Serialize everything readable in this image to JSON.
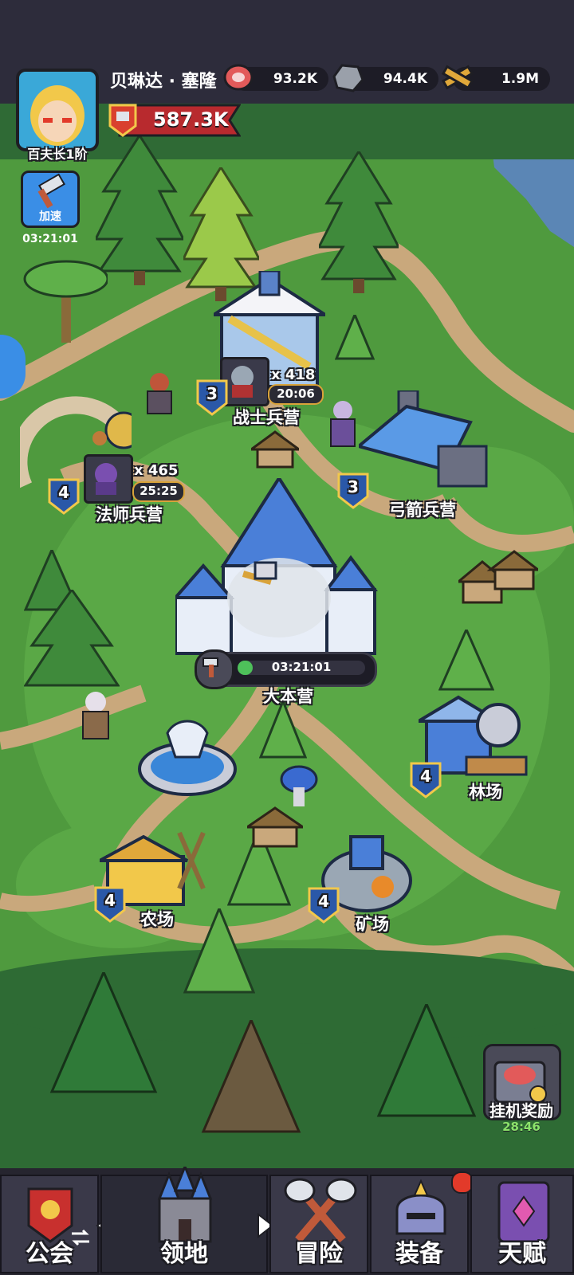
{
  "player": {
    "name": "贝琳达 · 塞隆",
    "rank": "百夫长1阶",
    "power": "587.3K"
  },
  "resources": [
    {
      "icon": "meat-icon",
      "value": "93.2K"
    },
    {
      "icon": "stone-icon",
      "value": "94.4K"
    },
    {
      "icon": "wood-icon",
      "value": "1.9M"
    }
  ],
  "speedup": {
    "label": "加速",
    "timer": "03:21:01"
  },
  "buildings": {
    "warrior": {
      "name": "战士兵营",
      "level": "3",
      "count": "x 418",
      "timer": "20:06"
    },
    "mage": {
      "name": "法师兵营",
      "level": "4",
      "count": "x 465",
      "timer": "25:25"
    },
    "archer": {
      "name": "弓箭兵营",
      "level": "3"
    },
    "hq": {
      "name": "大本营",
      "timer": "03:21:01",
      "progress": 0.12
    },
    "lumber": {
      "name": "林场",
      "level": "4"
    },
    "farm": {
      "name": "农场",
      "level": "4"
    },
    "mine": {
      "name": "矿场",
      "level": "4"
    }
  },
  "idle_reward": {
    "label": "挂机奖励",
    "timer": "28:46"
  },
  "nav": {
    "guild": "公会",
    "territory": "领地",
    "adventure": "冒险",
    "equipment": "装备",
    "talent": "天赋"
  },
  "colors": {
    "grass": "#4f9a3e",
    "path": "#c9a87c",
    "badge": "#2a58a8",
    "power_banner": "#b82a2e",
    "timer_green": "#4ec05a"
  }
}
